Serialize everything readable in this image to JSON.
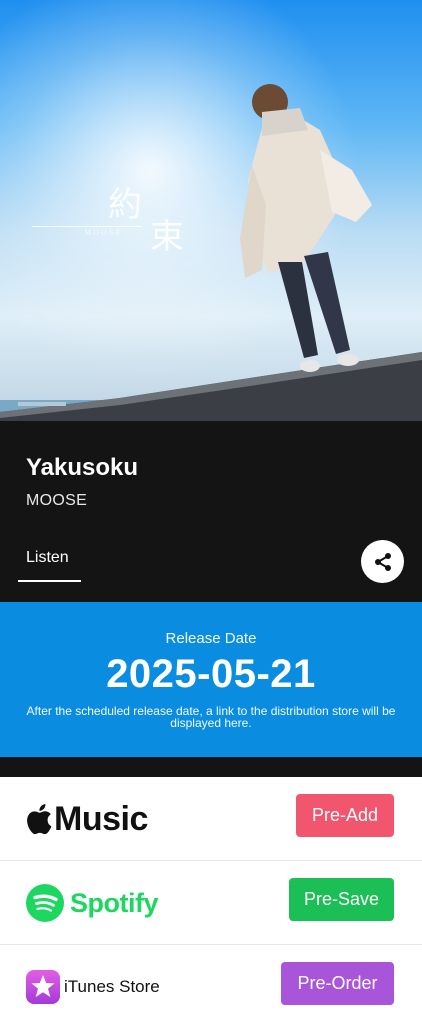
{
  "cover": {
    "title_line1": "約",
    "title_line2": "束",
    "artist_mark": "MOOSE"
  },
  "release_info": {
    "title": "Yakusoku",
    "artist": "MOOSE",
    "tab_label": "Listen"
  },
  "release": {
    "label": "Release Date",
    "date": "2025-05-21",
    "note": "After the scheduled release date, a link to the distribution store will be displayed here."
  },
  "stores": [
    {
      "name": "Music",
      "button": "Pre-Add",
      "icon": "apple-logo-icon",
      "color": "#f2566e"
    },
    {
      "name": "Spotify",
      "button": "Pre-Save",
      "icon": "spotify-logo-icon",
      "color": "#1cbf55"
    },
    {
      "name": "iTunes Store",
      "button": "Pre-Order",
      "icon": "itunes-star-icon",
      "color": "#a855d9"
    }
  ],
  "colors": {
    "dark_bg": "#141414",
    "release_blue": "#0a8de0"
  }
}
